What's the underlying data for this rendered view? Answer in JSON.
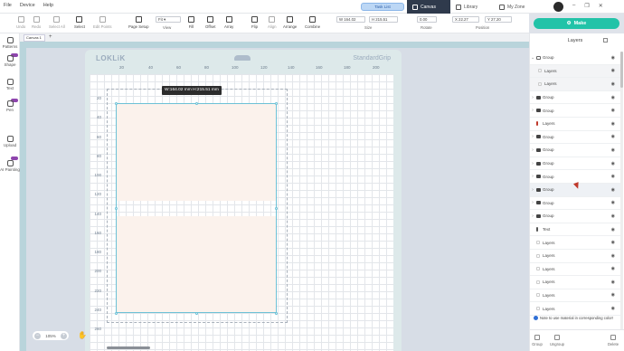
{
  "menu": [
    "File",
    "Device",
    "Help"
  ],
  "task_list": "Task List",
  "app_tabs": [
    "Canvas",
    "Library",
    "My Zone"
  ],
  "window_controls": [
    "–",
    "❐",
    "✕"
  ],
  "toolbar": {
    "tools": [
      "Undo",
      "Redo",
      "Select All",
      "Select",
      "Edit Points",
      "Page Setup",
      "View",
      "Fill",
      "Offset",
      "Array",
      "Flip",
      "Align",
      "Arrange",
      "Combine"
    ],
    "view_value": "Fit",
    "size_label": "Size",
    "size_w": "W 164.02",
    "size_h": "H 215.51",
    "rotate_label": "Rotate",
    "rotate_value": "0.00",
    "position_label": "Position",
    "pos_x": "X 22.27",
    "pos_y": "Y 27.20"
  },
  "make_button": "Make",
  "left_rail": [
    "Patterns",
    "Shape",
    "Text",
    "Pen",
    "Upload",
    "AI Painting"
  ],
  "doc_tab": "Canvas 1",
  "doc_tab_plus": "+",
  "mat": {
    "logo": "LOKLiK",
    "brand": "StandardGrip",
    "x_ticks": [
      "20",
      "40",
      "60",
      "80",
      "100",
      "120",
      "140",
      "160",
      "180",
      "200"
    ],
    "y_ticks": [
      "20",
      "40",
      "60",
      "80",
      "100",
      "120",
      "140",
      "160",
      "180",
      "200",
      "220",
      "240",
      "260"
    ]
  },
  "dimension_tooltip": "W:164.02 mm  H:215.51 mm",
  "zoom": {
    "minus": "−",
    "value": "105%",
    "plus": "+"
  },
  "layers": {
    "title": "Layers",
    "rows": [
      {
        "name": "Group",
        "type": "folder",
        "expanded": true
      },
      {
        "name": "Layers",
        "type": "child"
      },
      {
        "name": "Layers",
        "type": "child"
      },
      {
        "name": "Group",
        "type": "group"
      },
      {
        "name": "Group",
        "type": "group"
      },
      {
        "name": "Layers",
        "type": "red"
      },
      {
        "name": "Group",
        "type": "group"
      },
      {
        "name": "Group",
        "type": "group"
      },
      {
        "name": "Group",
        "type": "group"
      },
      {
        "name": "Group",
        "type": "group"
      },
      {
        "name": "Group",
        "type": "group",
        "highlight": true
      },
      {
        "name": "Group",
        "type": "group"
      },
      {
        "name": "Group",
        "type": "group"
      },
      {
        "name": "Text",
        "type": "bar"
      },
      {
        "name": "Layers",
        "type": "plain"
      },
      {
        "name": "Layers",
        "type": "plain"
      },
      {
        "name": "Layers",
        "type": "plain"
      },
      {
        "name": "Layers",
        "type": "plain"
      },
      {
        "name": "Layers",
        "type": "plain"
      },
      {
        "name": "Layers",
        "type": "plain"
      }
    ],
    "note": "Note to use material in corresponding color!",
    "footer": [
      "Group",
      "Ungroup",
      "Delete"
    ]
  },
  "colors": {
    "accent": "#22c3a8",
    "selection": "#6cc1d6",
    "shape_fill": "#fbf2ec",
    "dark_tab": "#2f3a4c"
  }
}
